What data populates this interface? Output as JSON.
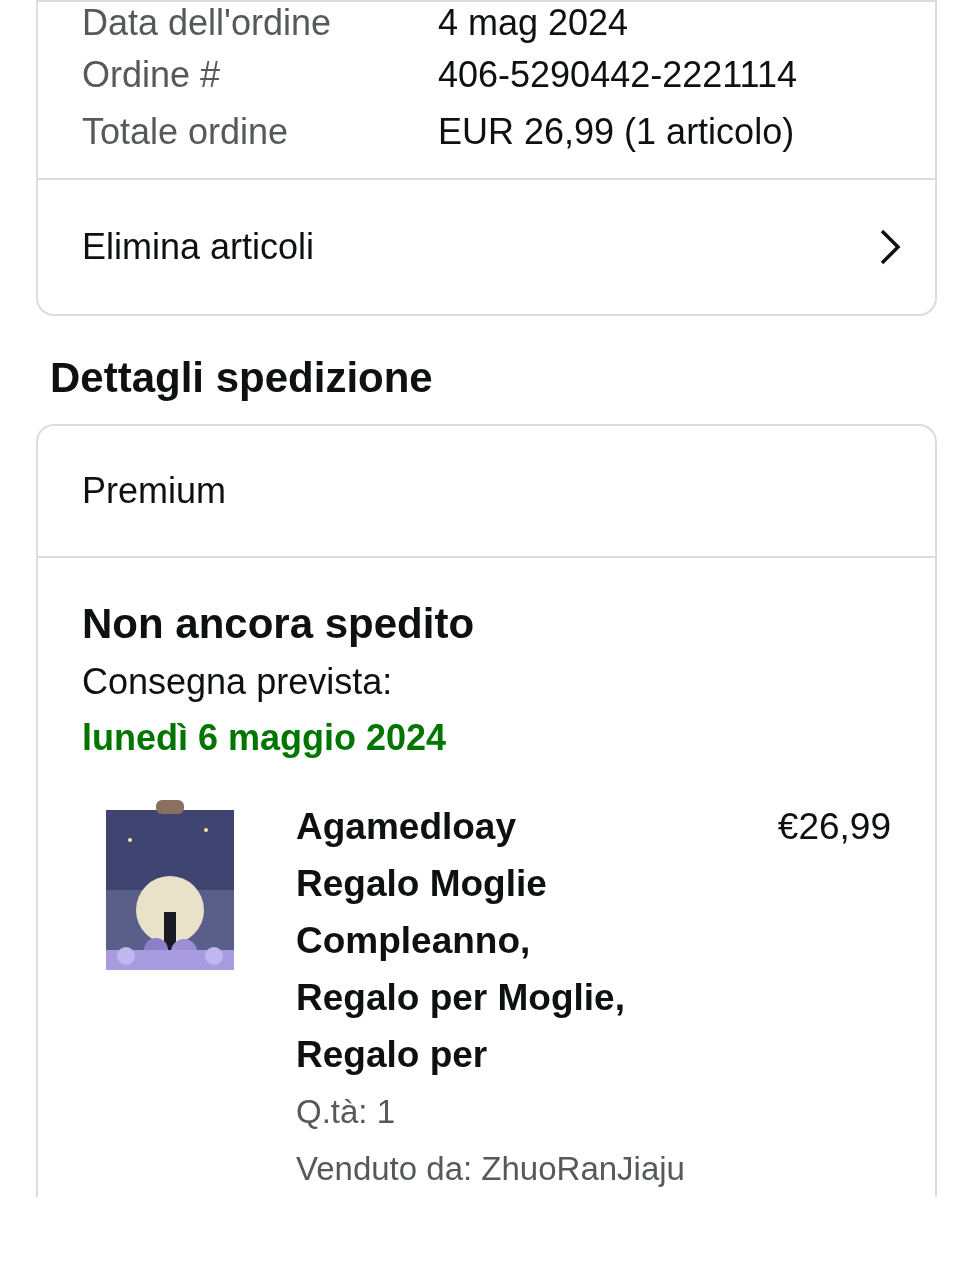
{
  "order_summary": {
    "rows": [
      {
        "label": "Data dell'ordine",
        "value": "4 mag 2024"
      },
      {
        "label": "Ordine #",
        "value": "406-5290442-2221114"
      },
      {
        "label": "Totale ordine",
        "value": "EUR 26,99 (1 articolo)"
      }
    ],
    "action": {
      "label": "Elimina articoli"
    }
  },
  "shipping": {
    "heading": "Dettagli spedizione",
    "service": "Premium",
    "status": "Non ancora spedito",
    "delivery_label": "Consegna prevista:",
    "delivery_date": "lunedì 6 maggio 2024",
    "item": {
      "title": "Agamedloay Regalo Moglie Compleanno, Regalo per Moglie, Regalo per",
      "price": "€26,99",
      "quantity": "Q.tà: 1",
      "seller": "Venduto da: ZhuoRanJiaju"
    }
  }
}
